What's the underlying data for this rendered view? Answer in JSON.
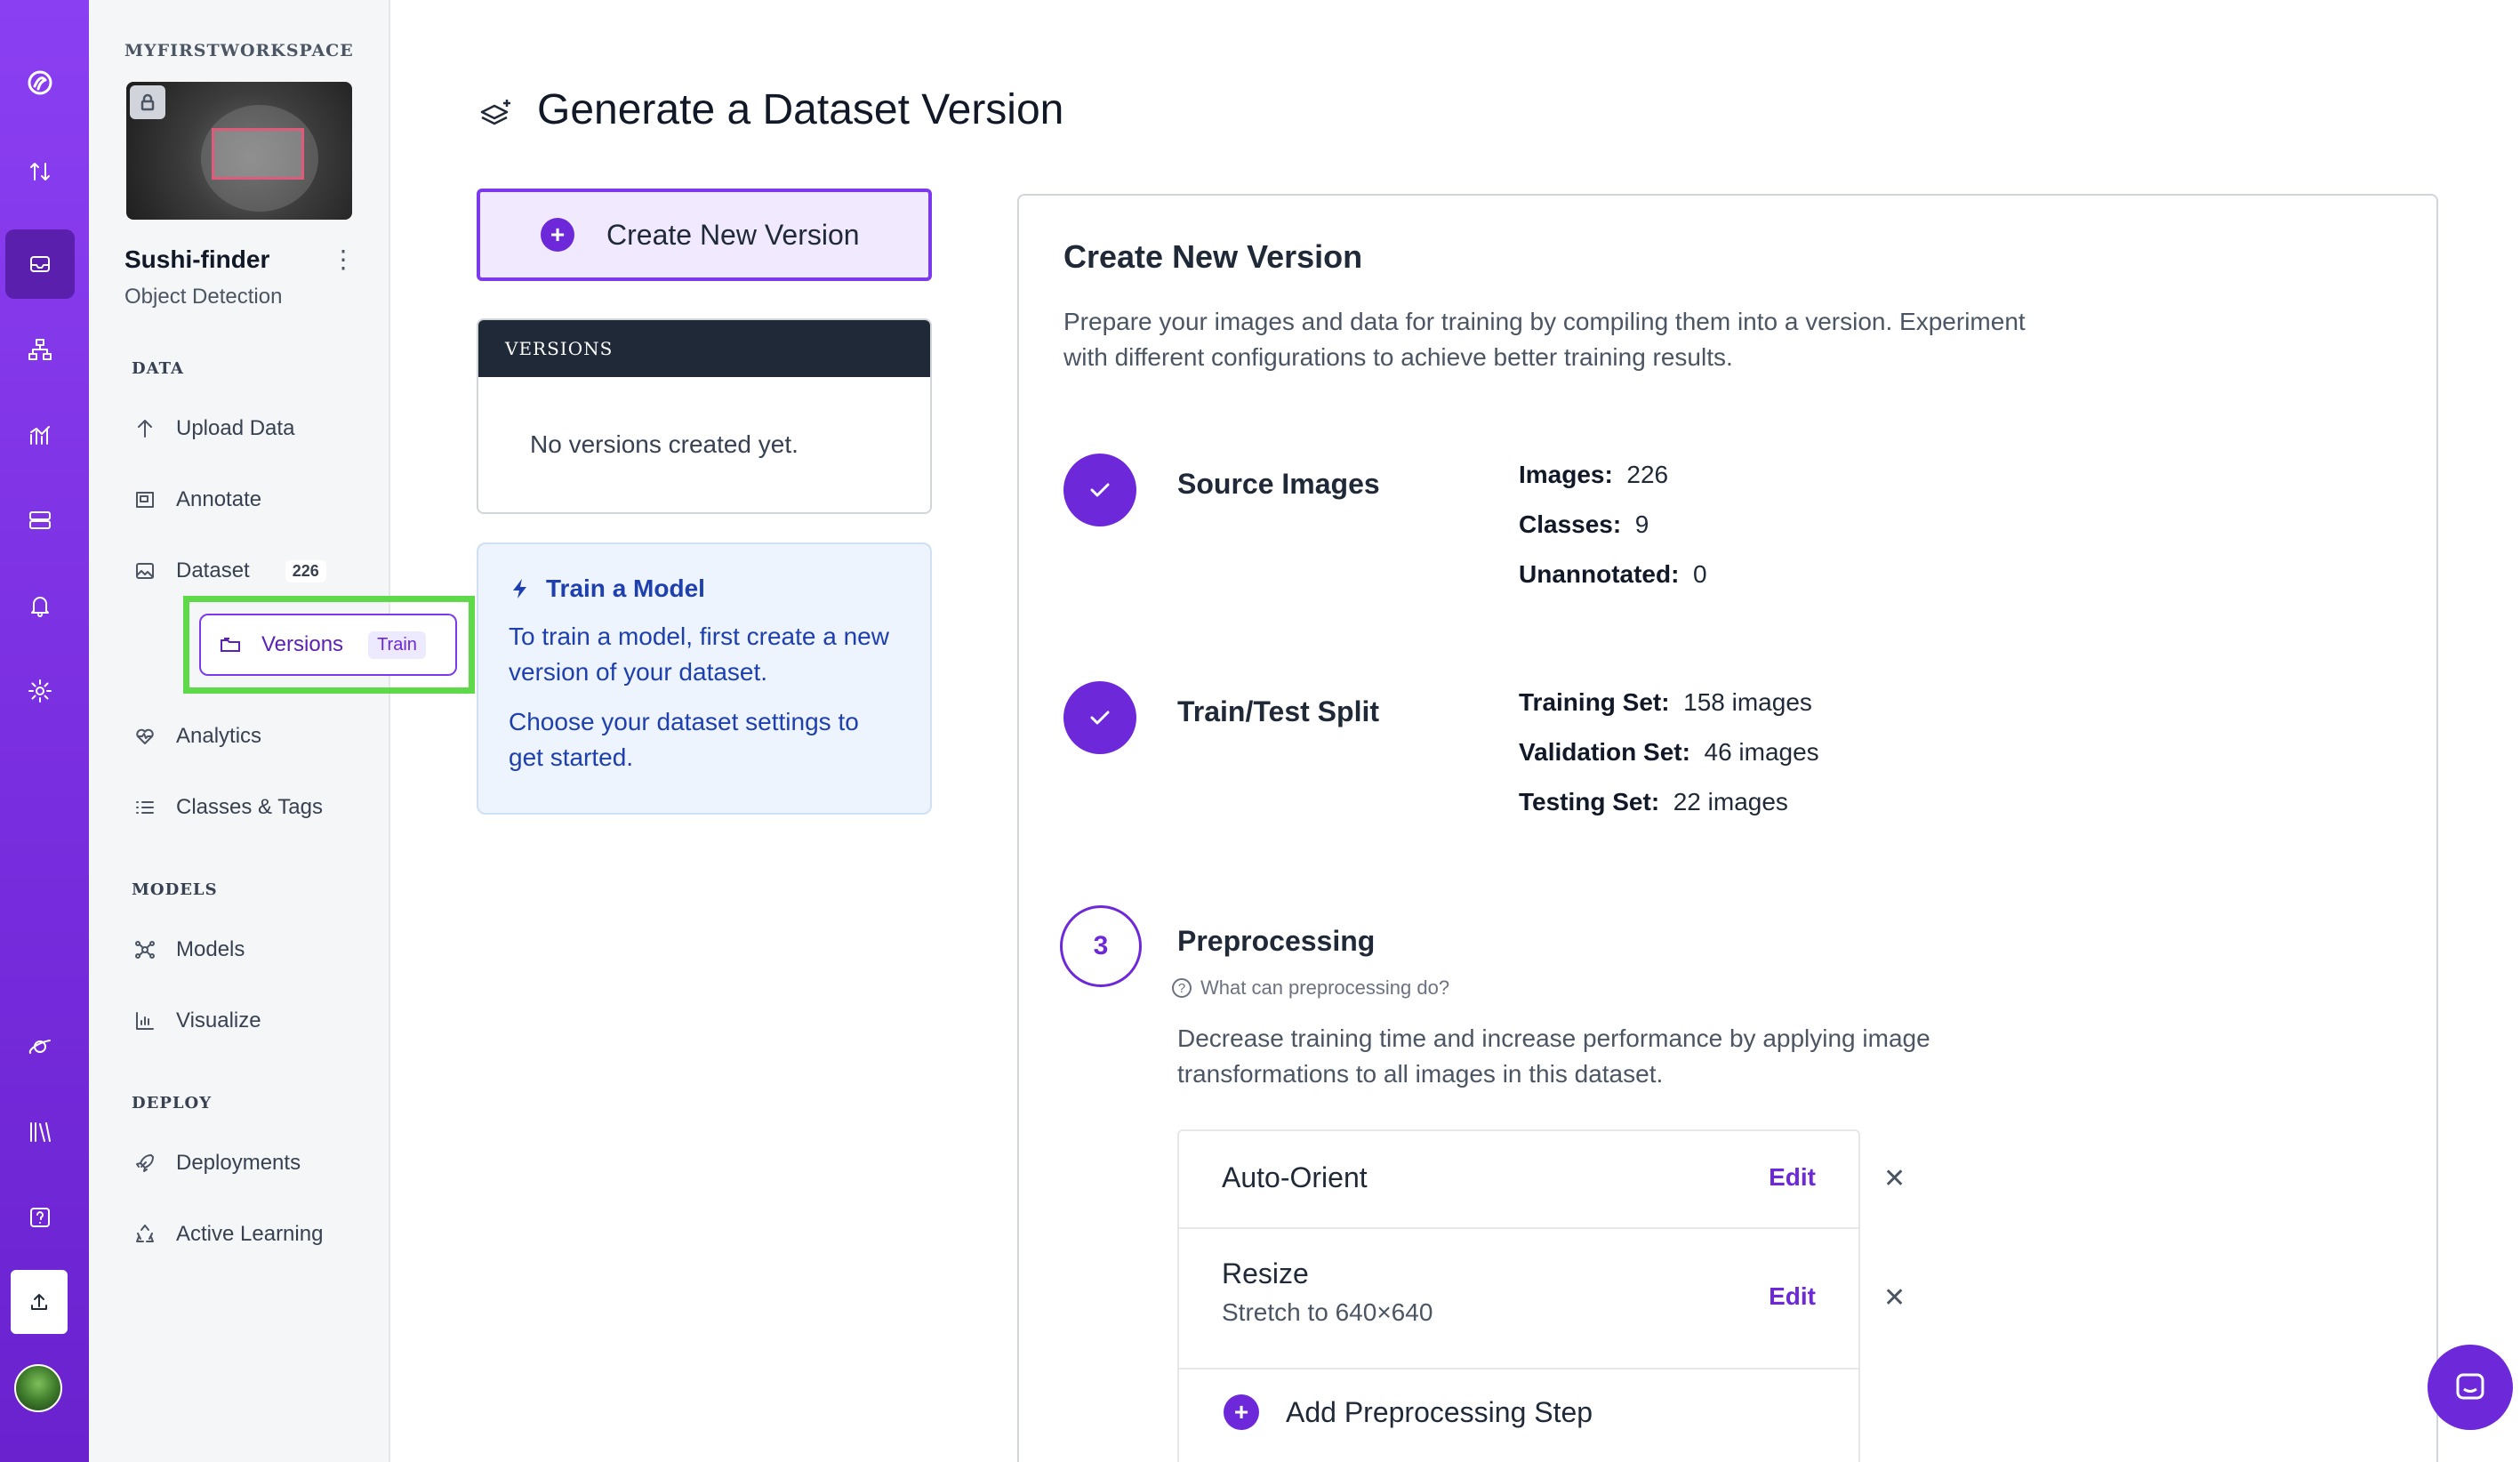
{
  "rail": {
    "items": [
      "logo-icon",
      "swap-icon",
      "inbox-icon",
      "sitemap-icon",
      "chart-icon",
      "server-icon",
      "bell-icon",
      "gear-icon",
      "planet-icon",
      "books-icon",
      "help-icon",
      "upload-icon"
    ]
  },
  "sidebar": {
    "workspace": "MYFIRSTWORKSPACE",
    "project_name": "Sushi-finder",
    "project_type": "Object Detection",
    "sections": {
      "data": "DATA",
      "models": "MODELS",
      "deploy": "DEPLOY"
    },
    "items": {
      "upload": "Upload Data",
      "annotate": "Annotate",
      "dataset": "Dataset",
      "dataset_count": "226",
      "versions": "Versions",
      "versions_tag": "Train",
      "analytics": "Analytics",
      "classes": "Classes & Tags",
      "models": "Models",
      "visualize": "Visualize",
      "deployments": "Deployments",
      "active_learning": "Active Learning"
    }
  },
  "main": {
    "title": "Generate a Dataset Version",
    "create_button": "Create New Version",
    "versions_header": "VERSIONS",
    "versions_empty": "No versions created yet.",
    "train": {
      "title": "Train a Model",
      "p1": "To train a model, first create a new version of your dataset.",
      "p2": "Choose your dataset settings to get started."
    }
  },
  "panel": {
    "title": "Create New Version",
    "desc": "Prepare your images and data for training by compiling them into a version. Experiment with different configurations to achieve better training results.",
    "source": {
      "name": "Source Images",
      "images_label": "Images:",
      "images": "226",
      "classes_label": "Classes:",
      "classes": "9",
      "unannotated_label": "Unannotated:",
      "unannotated": "0"
    },
    "split": {
      "name": "Train/Test Split",
      "training_label": "Training Set:",
      "training": "158 images",
      "validation_label": "Validation Set:",
      "validation": "46 images",
      "testing_label": "Testing Set:",
      "testing": "22 images"
    },
    "preprocessing": {
      "step": "3",
      "name": "Preprocessing",
      "help": "What can preprocessing do?",
      "desc": "Decrease training time and increase performance by applying image transformations to all images in this dataset.",
      "steps": [
        {
          "name": "Auto-Orient",
          "detail": "",
          "edit": "Edit"
        },
        {
          "name": "Resize",
          "detail": "Stretch to 640×640",
          "edit": "Edit"
        }
      ],
      "add_label": "Add Preprocessing Step"
    }
  },
  "colors": {
    "accent": "#6d28d9",
    "rail": "#7a2fe0",
    "highlight": "#5ed94a",
    "info": "#1e40af"
  }
}
